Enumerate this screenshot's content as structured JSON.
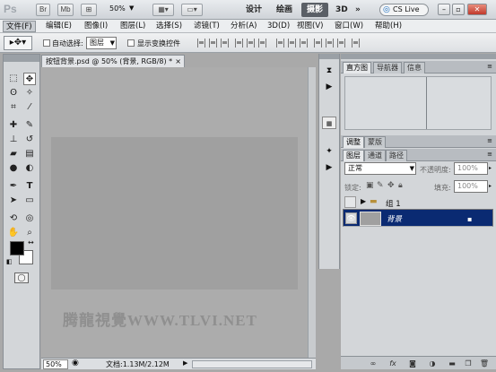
{
  "titlebar": {
    "logo": "Ps",
    "btn_br": "Br",
    "btn_mb": "Mb",
    "zoom": "50%",
    "workspaces": [
      "设计",
      "绘画",
      "摄影",
      "3D"
    ],
    "more": "»",
    "cs_live": "CS Live",
    "win_min": "–",
    "win_max": "▫",
    "win_close": "✕"
  },
  "menubar": {
    "items": [
      "文件(F)",
      "编辑(E)",
      "图像(I)",
      "图层(L)",
      "选择(S)",
      "滤镜(T)",
      "分析(A)",
      "3D(D)",
      "视图(V)",
      "窗口(W)",
      "帮助(H)"
    ]
  },
  "options": {
    "auto_select_label": "自动选择:",
    "auto_select_value": "图层",
    "show_transform_label": "显示变换控件"
  },
  "document": {
    "tab_title": "按钮背景.psd @ 50% (背景, RGB/8) *",
    "tab_close": "×",
    "watermark": "腾龍視覺WWW.TLVI.NET",
    "zoom": "50%",
    "doc_info": "文档:1.13M/2.12M"
  },
  "panels": {
    "top_tabs": [
      "直方图",
      "导航器",
      "信息"
    ],
    "mid_tabs": [
      "调整",
      "蒙版"
    ],
    "layer_tabs": [
      "图层",
      "通道",
      "路径"
    ],
    "blend_mode": "正常",
    "opacity_label": "不透明度:",
    "opacity_value": "100%",
    "lock_label": "锁定:",
    "fill_label": "填充:",
    "fill_value": "100%",
    "layers": [
      {
        "name": "组 1",
        "type": "group"
      },
      {
        "name": "背景",
        "type": "background",
        "selected": true
      }
    ],
    "bottom_icons": [
      "link",
      "fx",
      "mask",
      "adjust",
      "folder",
      "new",
      "trash"
    ]
  },
  "colors": {
    "layer_selected": "#0a2a72",
    "workspace_active": "#5a5f66"
  }
}
